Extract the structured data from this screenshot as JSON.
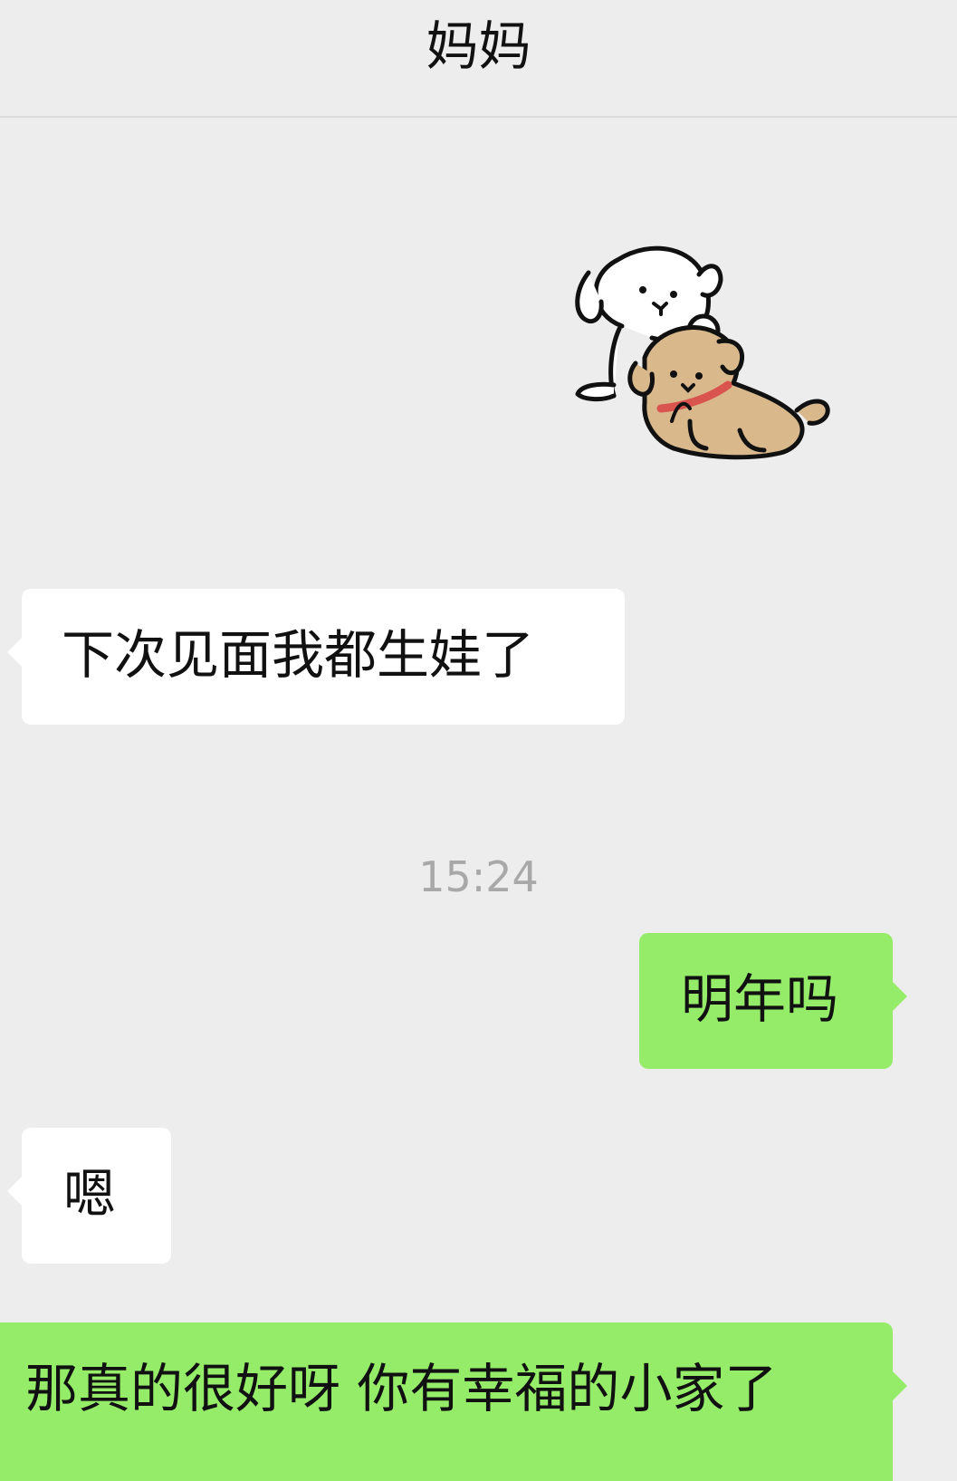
{
  "header": {
    "title": "妈妈"
  },
  "messages": [
    {
      "side": "in",
      "type": "sticker",
      "sticker_icon": "two-puppies-sticker-icon"
    },
    {
      "side": "in",
      "type": "text",
      "text": "下次见面我都生娃了"
    },
    {
      "side": "center",
      "type": "time",
      "text": "15:24"
    },
    {
      "side": "out",
      "type": "text",
      "text": "明年吗"
    },
    {
      "side": "in",
      "type": "text",
      "text": "嗯"
    },
    {
      "side": "out",
      "type": "text",
      "text": "那真的很好呀 你有幸福的小家了"
    }
  ],
  "colors": {
    "background": "#ededed",
    "incoming_bubble": "#ffffff",
    "outgoing_bubble": "#95ec69",
    "timestamp_text": "#a8a8a8"
  }
}
